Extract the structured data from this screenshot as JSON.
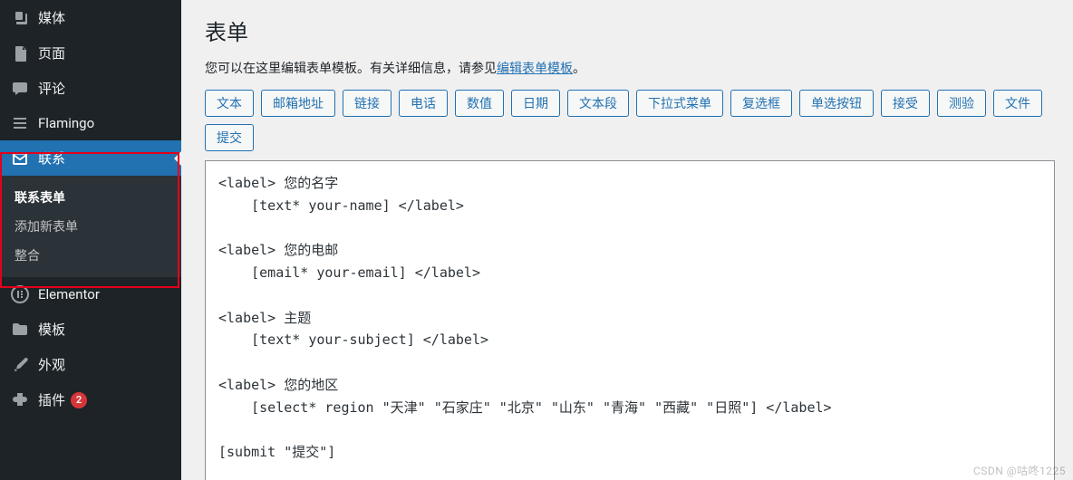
{
  "sidebar": {
    "items": [
      {
        "label": "媒体"
      },
      {
        "label": "页面"
      },
      {
        "label": "评论"
      },
      {
        "label": "Flamingo"
      },
      {
        "label": "联系"
      },
      {
        "label": "Elementor"
      },
      {
        "label": "模板"
      },
      {
        "label": "外观"
      },
      {
        "label": "插件"
      }
    ],
    "submenu": [
      "联系表单",
      "添加新表单",
      "整合"
    ],
    "plugins_badge": "2"
  },
  "main": {
    "title": "表单",
    "desc_pre": "您可以在这里编辑表单模板。有关详细信息，请参见",
    "desc_link": "编辑表单模板",
    "desc_post": "。",
    "tags": [
      "文本",
      "邮箱地址",
      "链接",
      "电话",
      "数值",
      "日期",
      "文本段",
      "下拉式菜单",
      "复选框",
      "单选按钮",
      "接受",
      "测验",
      "文件",
      "提交"
    ],
    "editor_content": "<label> 您的名字\n    [text* your-name] </label>\n\n<label> 您的电邮\n    [email* your-email] </label>\n\n<label> 主题\n    [text* your-subject] </label>\n\n<label> 您的地区\n    [select* region \"天津\" \"石家庄\" \"北京\" \"山东\" \"青海\" \"西藏\" \"日照\"] </label>\n\n[submit \"提交\"]"
  },
  "watermark": "CSDN @咕咚1225"
}
